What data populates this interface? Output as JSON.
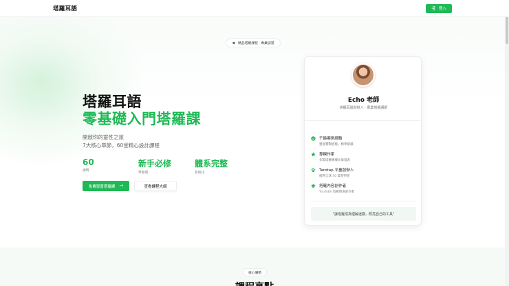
{
  "header": {
    "brand": "塔羅耳語",
    "login_label": "登入"
  },
  "hero": {
    "badge": "精品塔羅課程 · 專業認證",
    "title_line1": "塔羅耳語",
    "title_line2": "零基礎入門塔羅課",
    "desc_line1": "開啟你的靈性之旅",
    "desc_line2": "7大核心章節，60堂精心設計課程",
    "stats": [
      {
        "value": "60",
        "label": "課時"
      },
      {
        "value": "新手必修",
        "label": "零基礎"
      },
      {
        "value": "體系完整",
        "label": "系統化"
      }
    ],
    "primary_button": "免費學習塔羅課",
    "primary_arrow": "→",
    "secondary_button": "查看課程大綱"
  },
  "card": {
    "name": "Echo 老師",
    "subtitle": "塔羅耳語創辦人 · 專業塔羅講師",
    "features": [
      {
        "icon": "check-circle-icon",
        "title": "千餘案例經驗",
        "desc": "豐富實戰經驗，精準解讀"
      },
      {
        "icon": "star-icon",
        "title": "專欄作家",
        "desc": "多篇塔羅專欄文章發表"
      },
      {
        "icon": "paw-icon",
        "title": "Tarotap 平臺創辦人",
        "desc": "服務全球 30 萬使用者"
      },
      {
        "icon": "graduation-cap-icon",
        "title": "塔羅內容創作者",
        "desc": "YouTube 塔羅頻道創作者"
      }
    ],
    "quote": "\"讓塔羅成為理解迷霧，照亮自己的工具\""
  },
  "lower": {
    "badge": "核心優勢",
    "title": "課程亮點"
  },
  "colors": {
    "accent": "#1fb955",
    "text": "#111111",
    "muted": "#777777"
  }
}
